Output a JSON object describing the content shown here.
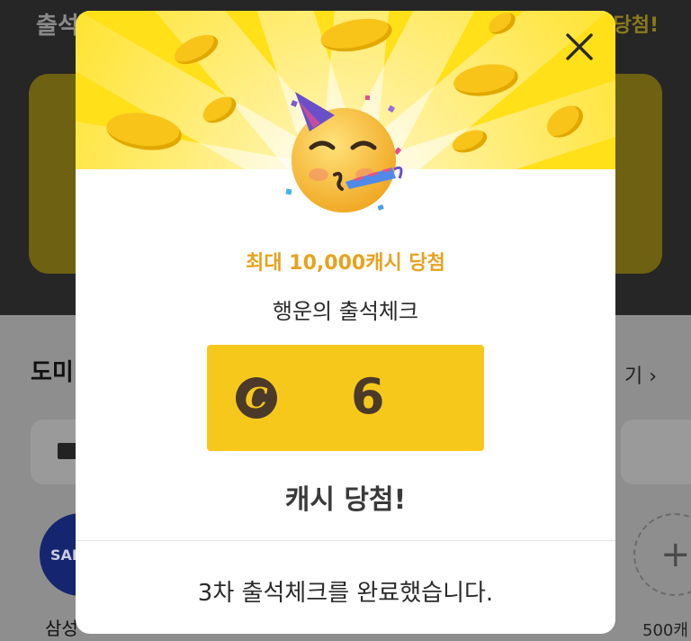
{
  "background": {
    "title": "출석",
    "title_right": "당첨!",
    "section_title": "도미",
    "more_label": "기 ›",
    "brand_circle": "SAM",
    "brand_label": "삼성",
    "add_icon": "plus-icon",
    "add_label": "500캐"
  },
  "modal": {
    "close_icon": "close-icon",
    "hero_emoji": "partying-face-emoji",
    "promo_text": "최대 10,000캐시 당첨",
    "subtitle": "행운의 출석체크",
    "cash_icon_glyph": "C",
    "result_value": "6",
    "result_label": "캐시 당첨!",
    "complete_message": "3차 출석체크를 완료했습니다.",
    "colors": {
      "hero_yellow": "#ffe019",
      "result_yellow": "#f7c81c",
      "promo_orange": "#e7a21e",
      "dark_brown": "#4b3a2a"
    }
  }
}
